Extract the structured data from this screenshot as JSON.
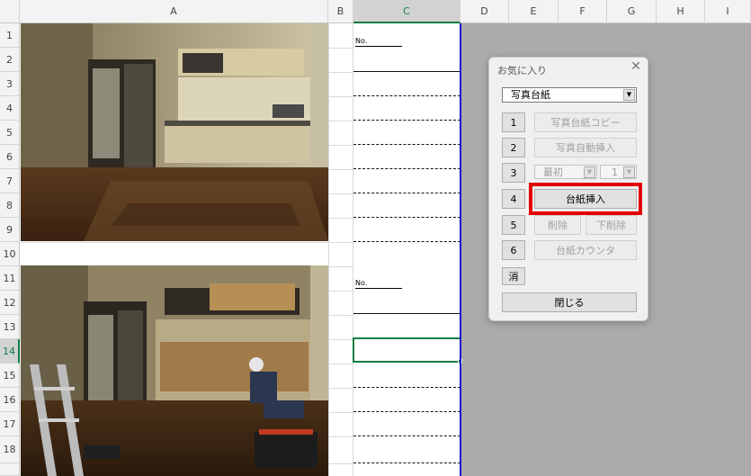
{
  "sheet": {
    "columns": [
      "A",
      "B",
      "C",
      "D",
      "E",
      "F",
      "G",
      "H",
      "I"
    ],
    "active_column": "C",
    "rows": [
      "1",
      "2",
      "3",
      "4",
      "5",
      "6",
      "7",
      "8",
      "9",
      "10",
      "11",
      "12",
      "13",
      "14",
      "15",
      "16",
      "17",
      "18"
    ],
    "active_row": "14",
    "no_label_1": "No.",
    "no_label_2": "No.",
    "photo_1": "kitchen-before-renovation-photo",
    "photo_2": "worker-demolishing-kitchen-photo"
  },
  "dialog": {
    "title": "お気に入り",
    "close_icon": "close-icon",
    "template_select": "写真台紙",
    "buttons": [
      {
        "num": "1",
        "label": "写真台紙コピー",
        "enabled": false
      },
      {
        "num": "2",
        "label": "写真自動挿入",
        "enabled": false
      },
      {
        "num": "3",
        "position_select": "最初",
        "count_select": "1",
        "enabled": false
      },
      {
        "num": "4",
        "label": "台紙挿入",
        "enabled": true
      },
      {
        "num": "5",
        "delete_label": "削除",
        "bottom_delete_label": "下削除",
        "enabled": false
      },
      {
        "num": "6",
        "label": "台紙カウンタ",
        "enabled": false
      }
    ],
    "clear_label": "消",
    "close_label": "閉じる"
  },
  "colors": {
    "highlight": "#e30000",
    "active_green": "#107c41",
    "print_border": "#1a1ac8"
  }
}
